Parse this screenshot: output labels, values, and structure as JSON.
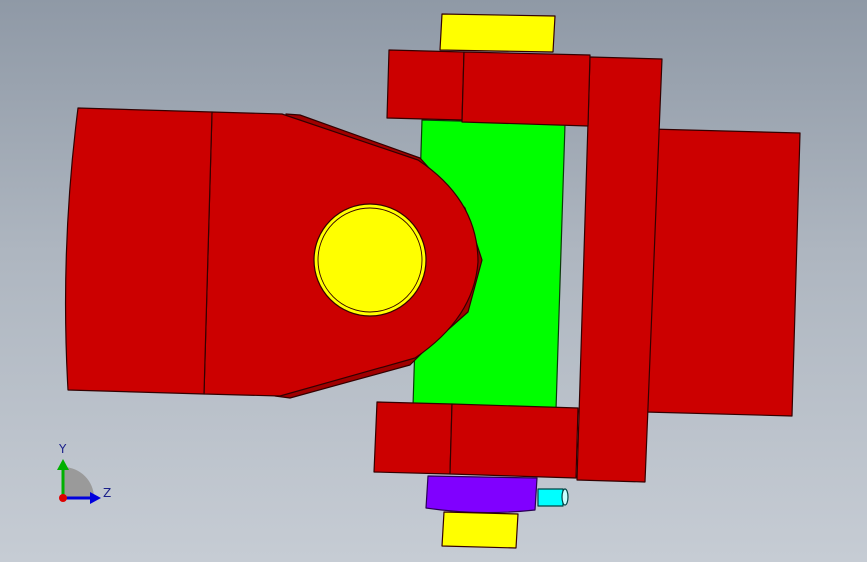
{
  "viewport": {
    "background_top": "#8f99a6",
    "background_bottom": "#c6ccd4"
  },
  "colors": {
    "yoke": "#cc0000",
    "edge": "#330000",
    "pin": "#ffff00",
    "cross_block": "#00ff00",
    "bushing": "#8000ff",
    "fitting": "#00ffff"
  },
  "triad": {
    "y_label": "Y",
    "z_label": "Z",
    "y_color": "#00b000",
    "z_color": "#0000dd",
    "x_color": "#dd0000"
  }
}
